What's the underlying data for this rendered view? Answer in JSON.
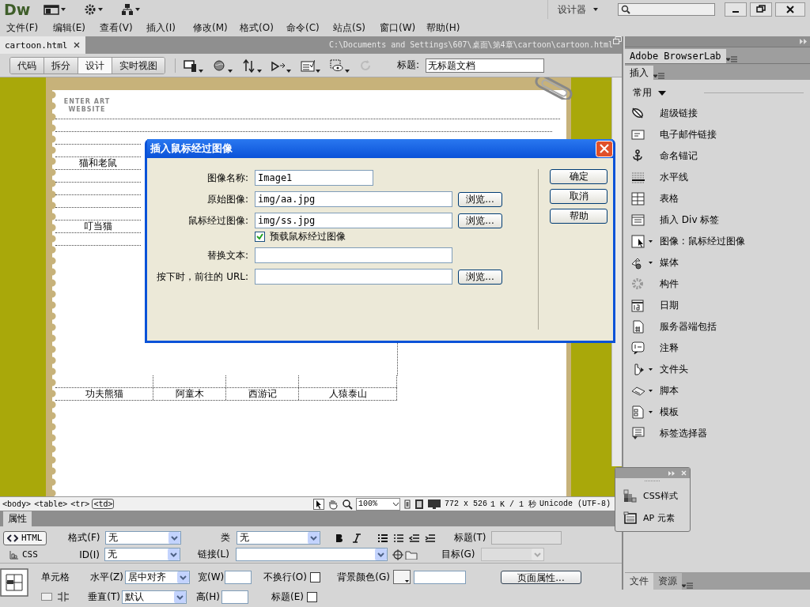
{
  "app": {
    "logo": "Dw",
    "workspace": "设计器"
  },
  "menu": [
    "文件(F)",
    "编辑(E)",
    "查看(V)",
    "插入(I)",
    "修改(M)",
    "格式(O)",
    "命令(C)",
    "站点(S)",
    "窗口(W)",
    "帮助(H)"
  ],
  "document_tab": {
    "filename": "cartoon.html",
    "path": "C:\\Documents and Settings\\607\\桌面\\第4章\\cartoon\\cartoon.html"
  },
  "view_buttons": [
    {
      "label": "代码",
      "selected": false
    },
    {
      "label": "拆分",
      "selected": false
    },
    {
      "label": "设计",
      "selected": true
    },
    {
      "label": "实时视图",
      "selected": false
    }
  ],
  "title_field": {
    "label": "标题:",
    "value": "无标题文档"
  },
  "page": {
    "logo_lines": [
      "ENTER ART",
      "WEBSITE"
    ],
    "side_cells": [
      "猫和老鼠",
      "叮当猫"
    ],
    "bottom_cells": [
      "功夫熊猫",
      "阿童木",
      "西游记",
      "人猿泰山"
    ]
  },
  "dialog": {
    "title": "插入鼠标经过图像",
    "rows": [
      {
        "kind": "short_field",
        "label": "图像名称:",
        "value": "Image1"
      },
      {
        "kind": "field",
        "label": "原始图像:",
        "value": "img/aa.jpg",
        "browse": "浏览..."
      },
      {
        "kind": "field",
        "label": "鼠标经过图像:",
        "value": "img/ss.jpg",
        "browse": "浏览..."
      },
      {
        "kind": "checkbox",
        "label": "预载鼠标经过图像",
        "checked": true
      },
      {
        "kind": "field",
        "label": "替换文本:"
      },
      {
        "kind": "field",
        "label": "按下时，前往的 URL:",
        "browse": "浏览..."
      }
    ],
    "buttons": [
      "确定",
      "取消",
      "帮助"
    ]
  },
  "tag_bar": {
    "tags": [
      {
        "label": "<body>",
        "selected": false
      },
      {
        "label": "<table>",
        "selected": false
      },
      {
        "label": "<tr>",
        "selected": false
      },
      {
        "label": "<td>",
        "selected": true
      }
    ],
    "zoom": "100%",
    "size": "772 x 526",
    "speed": "1 K / 1 秒",
    "encoding": "Unicode (UTF-8)"
  },
  "properties": {
    "title": "属性",
    "modes": [
      {
        "label": "HTML",
        "selected": true
      },
      {
        "label": "CSS",
        "selected": false
      }
    ],
    "format": {
      "label": "格式(F)",
      "value": "无"
    },
    "class": {
      "label": "类",
      "value": "无"
    },
    "heading": {
      "label": "标题(T)"
    },
    "id": {
      "label": "ID(I)",
      "value": "无"
    },
    "link": {
      "label": "链接(L)"
    },
    "target": {
      "label": "目标(G)"
    },
    "cell": {
      "label": "单元格"
    },
    "horizontal": {
      "label": "水平(Z)",
      "value": "居中对齐"
    },
    "width": {
      "label": "宽(W)"
    },
    "nowrap": {
      "label": "不换行(O)",
      "checked": false
    },
    "bgcolor": {
      "label": "背景颜色(G)"
    },
    "page_props": "页面属性...",
    "vertical": {
      "label": "垂直(T)",
      "value": "默认"
    },
    "height": {
      "label": "高(H)"
    },
    "header": {
      "label": "标题(E)",
      "checked": false
    }
  },
  "panels": {
    "browserlab": "Adobe BrowserLab",
    "insert_tab": "插入",
    "category": "常用",
    "items": [
      {
        "label": "超级链接",
        "menu": false
      },
      {
        "label": "电子邮件链接",
        "menu": false
      },
      {
        "label": "命名锚记",
        "menu": false
      },
      {
        "label": "水平线",
        "menu": false
      },
      {
        "label": "表格",
        "menu": false
      },
      {
        "label": "插入 Div 标签",
        "menu": false
      },
      {
        "label": "图像 : 鼠标经过图像",
        "menu": true
      },
      {
        "label": "媒体",
        "menu": true
      },
      {
        "label": "构件",
        "menu": false
      },
      {
        "label": "日期",
        "menu": false
      },
      {
        "label": "服务器端包括",
        "menu": false
      },
      {
        "label": "注释",
        "menu": false
      },
      {
        "label": "文件头",
        "menu": true
      },
      {
        "label": "脚本",
        "menu": true
      },
      {
        "label": "模板",
        "menu": true
      },
      {
        "label": "标签选择器",
        "menu": false
      }
    ],
    "bottom_tabs": [
      {
        "label": "文件",
        "selected": true
      },
      {
        "label": "资源",
        "selected": false
      }
    ]
  },
  "float_panel": {
    "items": [
      "CSS样式",
      "AP 元素"
    ]
  }
}
